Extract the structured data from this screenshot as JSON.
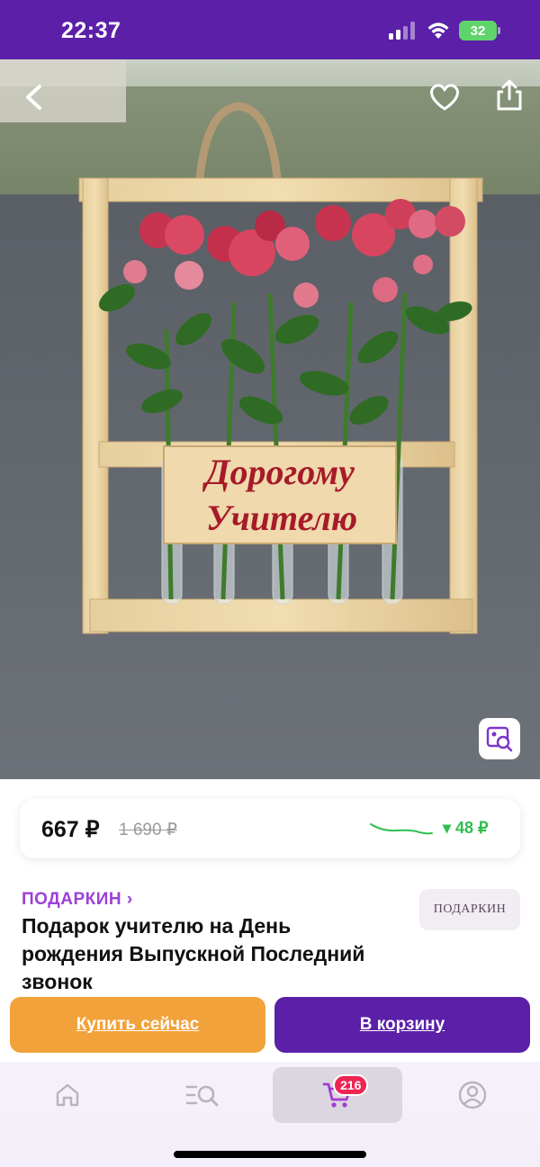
{
  "status_bar": {
    "time": "22:37",
    "battery": "32",
    "icons": [
      "signal-icon",
      "wifi-icon",
      "battery-icon"
    ]
  },
  "product_image": {
    "sign_line_1": "Дорогому",
    "sign_line_2": "Учителю",
    "nav_icons": [
      "back-icon",
      "heart-icon",
      "share-icon",
      "image-search-icon"
    ]
  },
  "price": {
    "current": "667 ₽",
    "old": "1 690 ₽",
    "drop": "▾ 48 ₽"
  },
  "brand": {
    "link_label": "ПОДАРКИН ›",
    "logo_text": "ПОДАРКИН"
  },
  "product": {
    "title": "Подарок учителю на День рождения Выпускной Последний звонок"
  },
  "actions": {
    "buy_now": "Купить сейчас",
    "add_to_cart": "В корзину"
  },
  "tabbar": {
    "items": [
      "home-icon",
      "catalog-search-icon",
      "cart-icon",
      "profile-icon"
    ],
    "cart_count": "216"
  },
  "colors": {
    "brand_purple": "#5b1fa8",
    "accent_orange": "#f2a23a",
    "price_drop_green": "#2fbf50",
    "badge_red": "#ee2453",
    "brand_link": "#9c40d8"
  }
}
